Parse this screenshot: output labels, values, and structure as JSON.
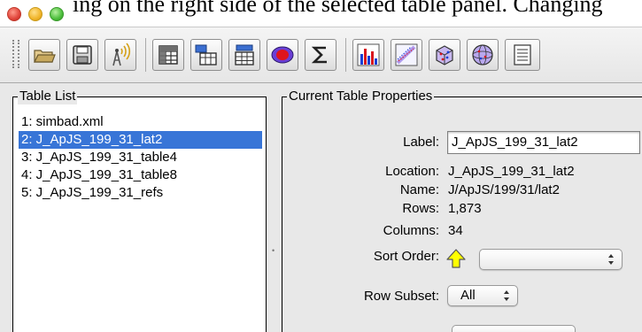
{
  "window": {
    "partial_heading_text": "ing on the right side of the selected table panel. Changing"
  },
  "toolbar": {
    "buttons": [
      {
        "icon": "open-folder-icon"
      },
      {
        "icon": "save-disk-icon"
      },
      {
        "icon": "broadcast-icon"
      },
      {
        "icon": "table-grid-icon"
      },
      {
        "icon": "columns-info-icon"
      },
      {
        "icon": "parameters-table-icon"
      },
      {
        "icon": "subset-ellipse-icon"
      },
      {
        "icon": "sigma-statistics-icon"
      },
      {
        "icon": "histogram-icon"
      },
      {
        "icon": "scatter-plot-icon"
      },
      {
        "icon": "3d-cube-plot-icon"
      },
      {
        "icon": "sphere-plot-icon"
      },
      {
        "icon": "truncated-icon"
      }
    ]
  },
  "table_list": {
    "legend": "Table List",
    "items": [
      {
        "label": "1: simbad.xml",
        "selected": false
      },
      {
        "label": "2: J_ApJS_199_31_lat2",
        "selected": true
      },
      {
        "label": "3: J_ApJS_199_31_table4",
        "selected": false
      },
      {
        "label": "4: J_ApJS_199_31_table8",
        "selected": false
      },
      {
        "label": "5: J_ApJS_199_31_refs",
        "selected": false
      }
    ]
  },
  "properties": {
    "legend": "Current Table Properties",
    "label_label": "Label:",
    "label_value": "J_ApJS_199_31_lat2",
    "location_label": "Location:",
    "location_value": "J_ApJS_199_31_lat2",
    "name_label": "Name:",
    "name_value": "J/ApJS/199/31/lat2",
    "rows_label": "Rows:",
    "rows_value": "1,873",
    "columns_label": "Columns:",
    "columns_value": "34",
    "sort_order_label": "Sort Order:",
    "sort_order_value": "",
    "row_subset_label": "Row Subset:",
    "row_subset_value": "All"
  },
  "colors": {
    "selection": "#3875d7",
    "panel_background": "#e8e8e8",
    "sort_arrow": "#ffff00"
  }
}
